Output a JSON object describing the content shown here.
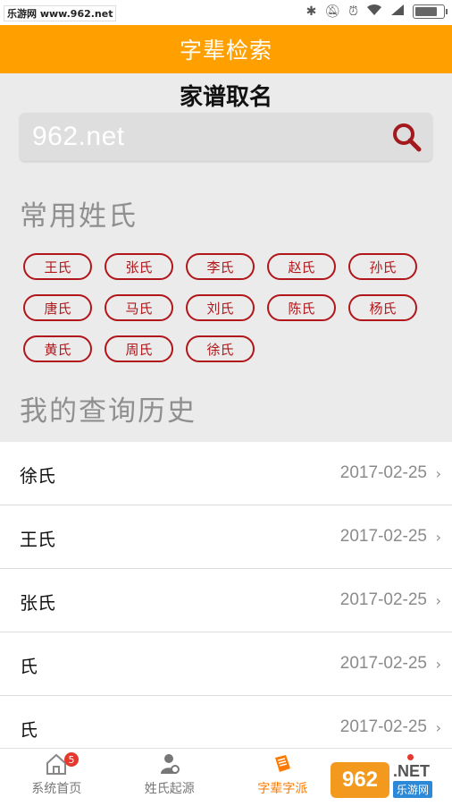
{
  "statusbar": {
    "watermark": "乐游网 www.962.net",
    "icons": [
      "bluetooth-icon",
      "mute-icon",
      "alarm-icon",
      "wifi-icon",
      "signal-icon",
      "battery-icon"
    ]
  },
  "header": {
    "title": "字辈检索"
  },
  "overlay": {
    "title": "家谱取名"
  },
  "search": {
    "placeholder": "962.net"
  },
  "common_surnames": {
    "heading": "常用姓氏",
    "items": [
      "王氏",
      "张氏",
      "李氏",
      "赵氏",
      "孙氏",
      "唐氏",
      "马氏",
      "刘氏",
      "陈氏",
      "杨氏",
      "黄氏",
      "周氏",
      "徐氏"
    ]
  },
  "history": {
    "heading": "我的查询历史",
    "rows": [
      {
        "name": "徐氏",
        "date": "2017-02-25"
      },
      {
        "name": "王氏",
        "date": "2017-02-25"
      },
      {
        "name": "张氏",
        "date": "2017-02-25"
      },
      {
        "name": "氏",
        "date": "2017-02-25"
      },
      {
        "name": "氏",
        "date": "2017-02-25"
      }
    ]
  },
  "tabs": {
    "home": {
      "label": "系统首页",
      "badge": "5"
    },
    "origin": {
      "label": "姓氏起源"
    },
    "generation": {
      "label": "字辈字派"
    }
  },
  "watermark_bottom": {
    "logo": "962",
    "net": ".NET",
    "sub": "乐游网"
  },
  "colors": {
    "accent": "#ff9f00",
    "chip": "#b0161a",
    "active_tab": "#ff7a00"
  }
}
